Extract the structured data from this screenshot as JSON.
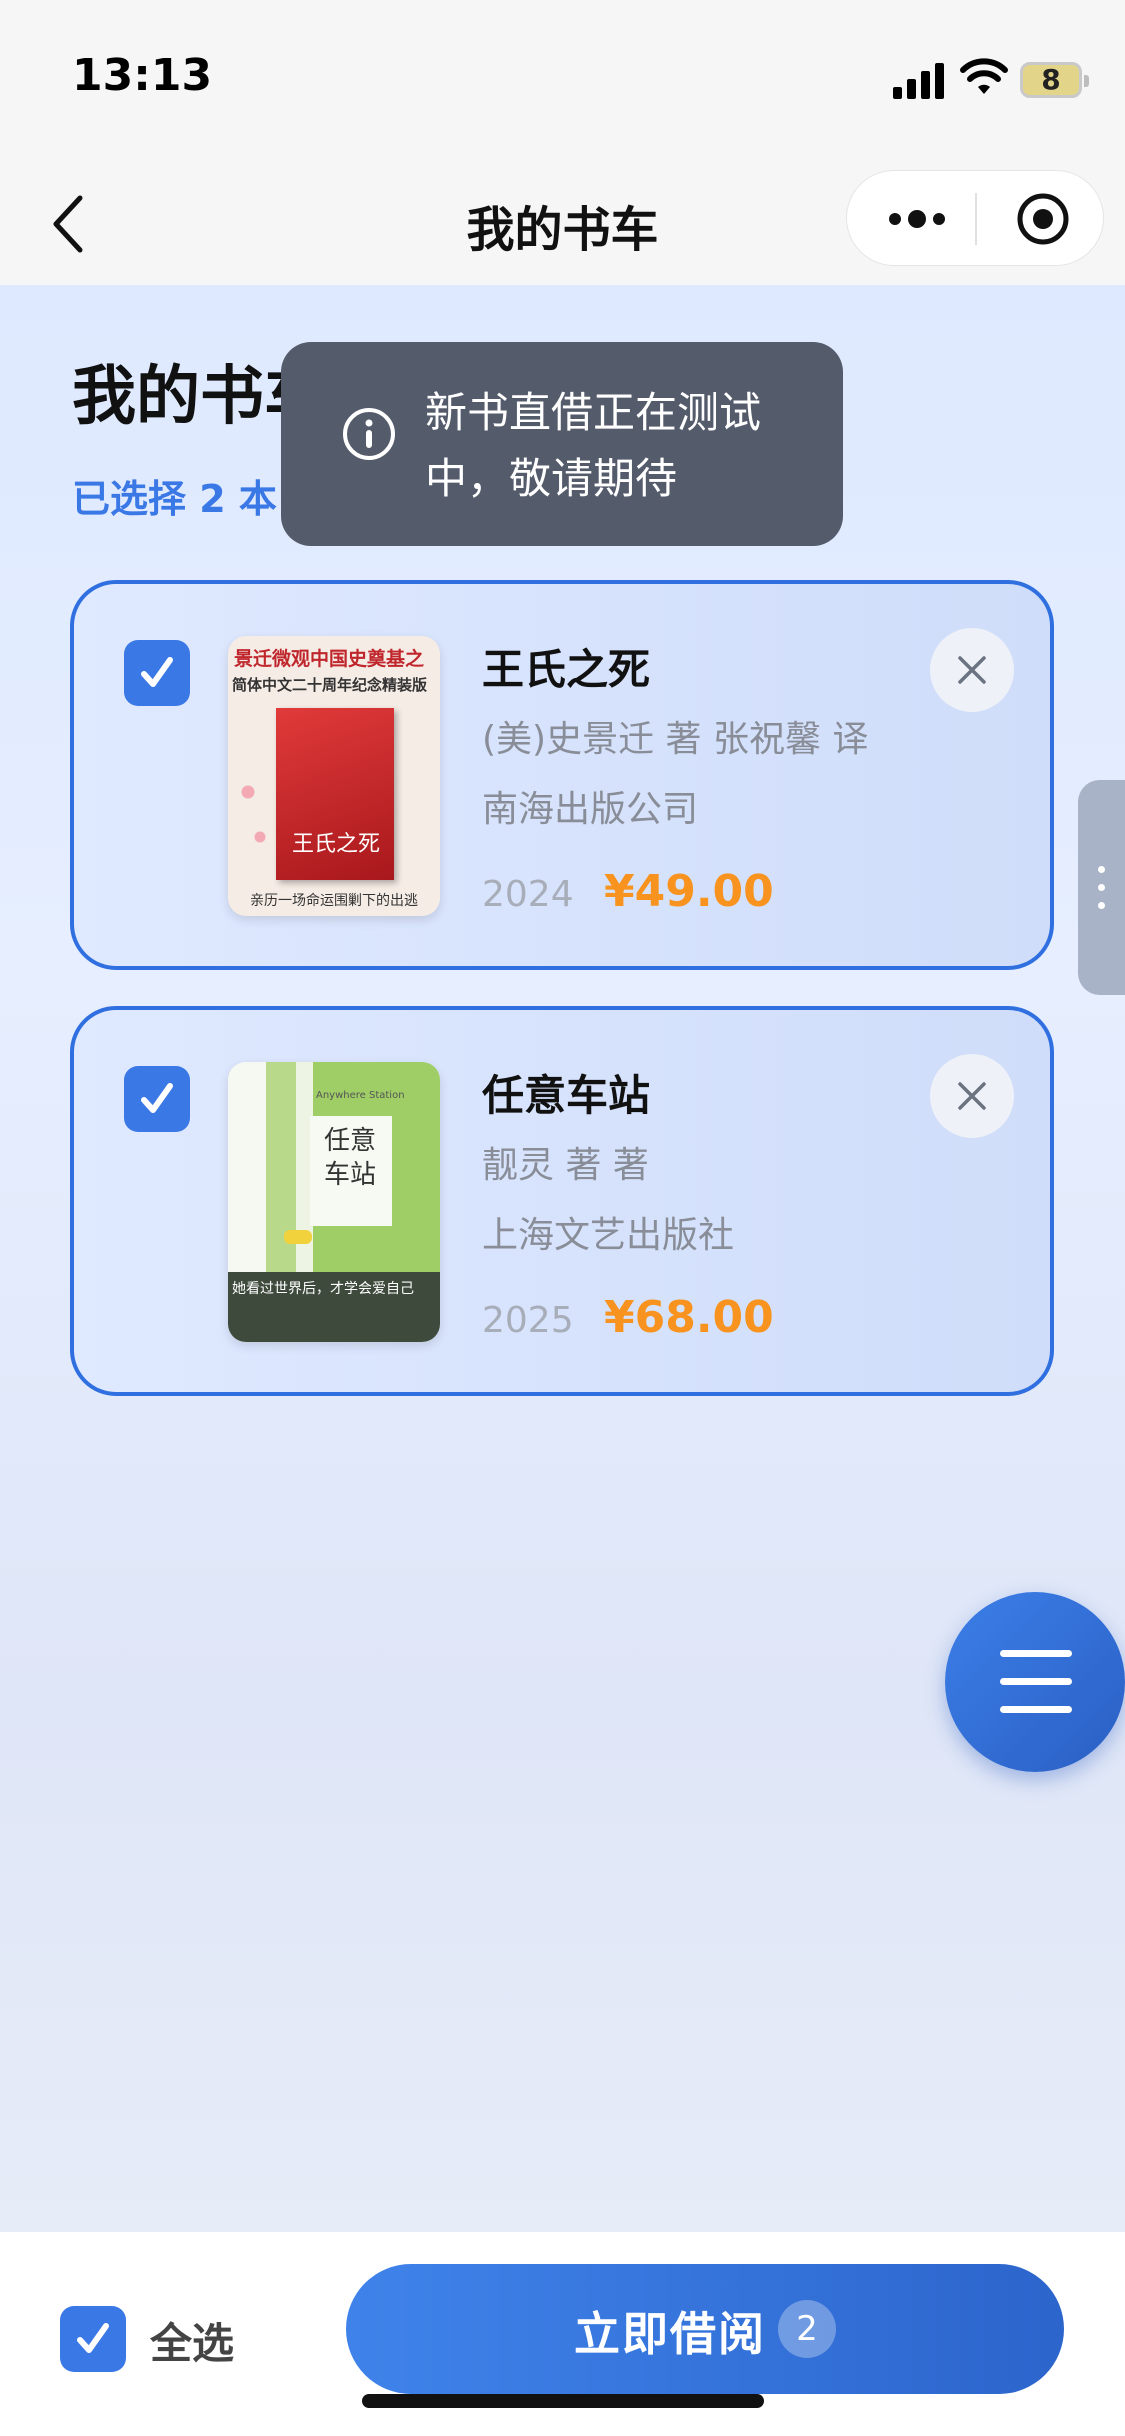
{
  "status_bar": {
    "time": "13:13",
    "battery": "8"
  },
  "nav": {
    "title": "我的书车"
  },
  "page": {
    "title": "我的书车",
    "selected_text": "已选择 2 本"
  },
  "toast": {
    "text": "新书直借正在测试中，敬请期待",
    "icon": "info-icon"
  },
  "books": [
    {
      "title": "王氏之死",
      "author": "(美)史景迁 著 张祝馨 译",
      "publisher": "南海出版公司",
      "year": "2024",
      "price": "¥49.00",
      "checked": true,
      "cover": {
        "top_line": "景迁微观中国史奠基之",
        "second_line": "简体中文二十周年纪念精装版",
        "name": "王氏之死",
        "bottom": "亲历一场命运围剿下的出逃"
      }
    },
    {
      "title": "任意车站",
      "author": "靓灵 著 著",
      "publisher": "上海文艺出版社",
      "year": "2025",
      "price": "¥68.00",
      "checked": true,
      "cover": {
        "name": "任意车站",
        "english": "Anywhere Station",
        "bottom": "她看过世界后，才学会爱自己"
      }
    }
  ],
  "bottom_bar": {
    "select_all_label": "全选",
    "borrow_label": "立即借阅",
    "borrow_count": "2"
  },
  "colors": {
    "accent": "#3a78e6",
    "price": "#f7931e",
    "toast_bg": "#545b6b"
  }
}
